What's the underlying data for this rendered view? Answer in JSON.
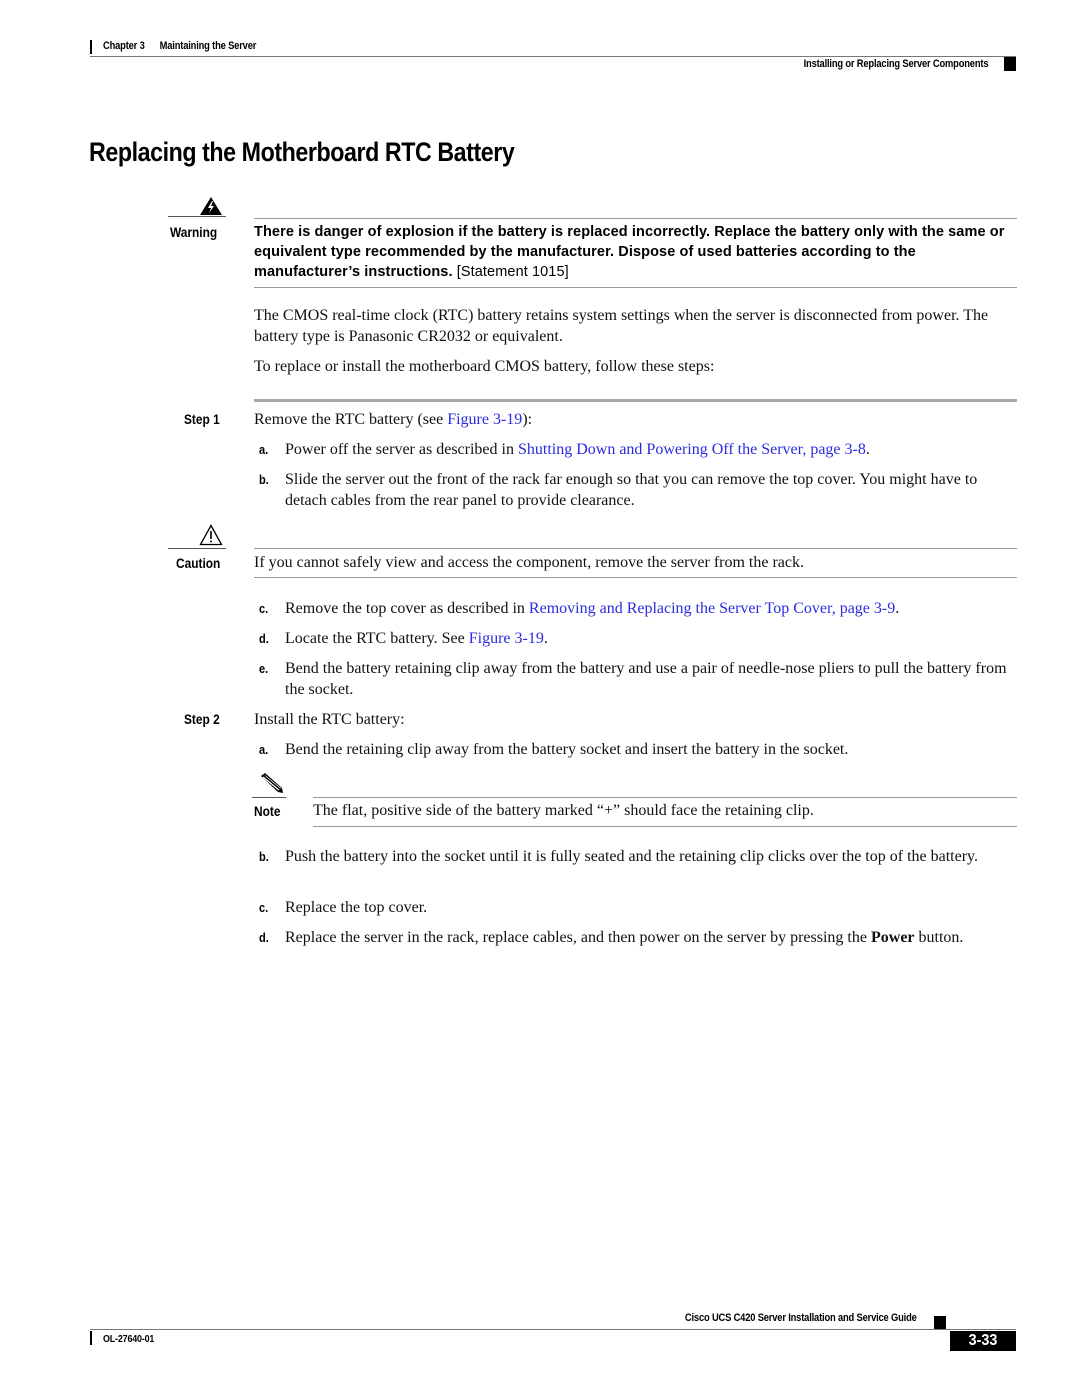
{
  "header": {
    "chapter": "Chapter 3",
    "chapter_title": "Maintaining the Server",
    "section": "Installing or Replacing Server Components"
  },
  "page_title": "Replacing the Motherboard RTC Battery",
  "warning": {
    "icon": "warning-lightning-icon",
    "label": "Warning",
    "text_bold": "There is danger of explosion if the battery is replaced incorrectly. Replace the battery only with the same or equivalent type recommended by the manufacturer. Dispose of used batteries according to the manufacturer’s instructions.",
    "statement": "[Statement 1015]"
  },
  "intro": {
    "p1": "The CMOS real-time clock (RTC) battery retains system settings when the server is disconnected from power. The battery type is Panasonic CR2032 or equivalent.",
    "p2": "To replace or install the motherboard CMOS battery, follow these steps:"
  },
  "step1": {
    "label": "Step 1",
    "text_before": "Remove the RTC battery (see ",
    "link": "Figure 3-19",
    "text_after": "):",
    "substeps": {
      "a": {
        "letter": "a.",
        "text_before": "Power off the server as described in ",
        "link": "Shutting Down and Powering Off the Server, page 3-8",
        "text_after": "."
      },
      "b": {
        "letter": "b.",
        "text": "Slide the server out the front of the rack far enough so that you can remove the top cover. You might have to detach cables from the rear panel to provide clearance."
      },
      "c": {
        "letter": "c.",
        "text_before": "Remove the top cover as described in ",
        "link": "Removing and Replacing the Server Top Cover, page 3-9",
        "text_after": "."
      },
      "d": {
        "letter": "d.",
        "text_before": "Locate the RTC battery. See ",
        "link": "Figure 3-19",
        "text_after": "."
      },
      "e": {
        "letter": "e.",
        "text": "Bend the battery retaining clip away from the battery and use a pair of needle-nose pliers to pull the battery from the socket."
      }
    }
  },
  "caution": {
    "icon": "caution-triangle-icon",
    "label": "Caution",
    "text": "If you cannot safely view and access the component, remove the server from the rack."
  },
  "step2": {
    "label": "Step 2",
    "text": "Install the RTC battery:",
    "substeps": {
      "a": {
        "letter": "a.",
        "text": "Bend the retaining clip away from the battery socket and insert the battery in the socket."
      },
      "b": {
        "letter": "b.",
        "text": "Push the battery into the socket until it is fully seated and the retaining clip clicks over the top of the battery."
      },
      "c": {
        "letter": "c.",
        "text": "Replace the top cover."
      },
      "d": {
        "letter": "d.",
        "text_before": "Replace the server in the rack, replace cables, and then power on the server by pressing the ",
        "bold": "Power",
        "text_after": " button."
      }
    }
  },
  "note": {
    "icon": "note-pencil-icon",
    "label": "Note",
    "text": "The flat, positive side of the battery marked “+” should face the retaining clip."
  },
  "footer": {
    "guide_title": "Cisco UCS C420 Server Installation and Service Guide",
    "doc_number": "OL-27640-01",
    "page_number": "3-33"
  }
}
